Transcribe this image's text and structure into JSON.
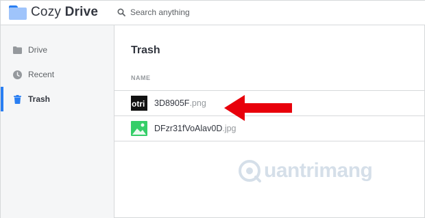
{
  "app": {
    "name_regular": "Cozy",
    "name_bold": "Drive",
    "icon": "folder-icon"
  },
  "search": {
    "placeholder": "Search anything",
    "icon": "search-icon"
  },
  "sidebar": {
    "items": [
      {
        "label": "Drive",
        "icon": "folder-icon",
        "active": false
      },
      {
        "label": "Recent",
        "icon": "clock-icon",
        "active": false
      },
      {
        "label": "Trash",
        "icon": "trash-icon",
        "active": true
      }
    ]
  },
  "main": {
    "title": "Trash",
    "column_header": "NAME",
    "files": [
      {
        "name": "3D8905F",
        "ext": ".png",
        "thumb": "image-thumbnail"
      },
      {
        "name": "DFzr31fVoAlav0D",
        "ext": ".jpg",
        "thumb": "image-file-icon"
      }
    ]
  },
  "annotation": {
    "arrow_color": "#e8000b",
    "icon": "arrow-left-icon"
  },
  "watermark": {
    "text": "uantrimang",
    "icon": "quantrimang-logo-icon"
  },
  "colors": {
    "accent": "#297ef2",
    "sidebar_bg": "#f5f6f7",
    "border": "#d6d8da",
    "image_icon": "#35ce68"
  }
}
